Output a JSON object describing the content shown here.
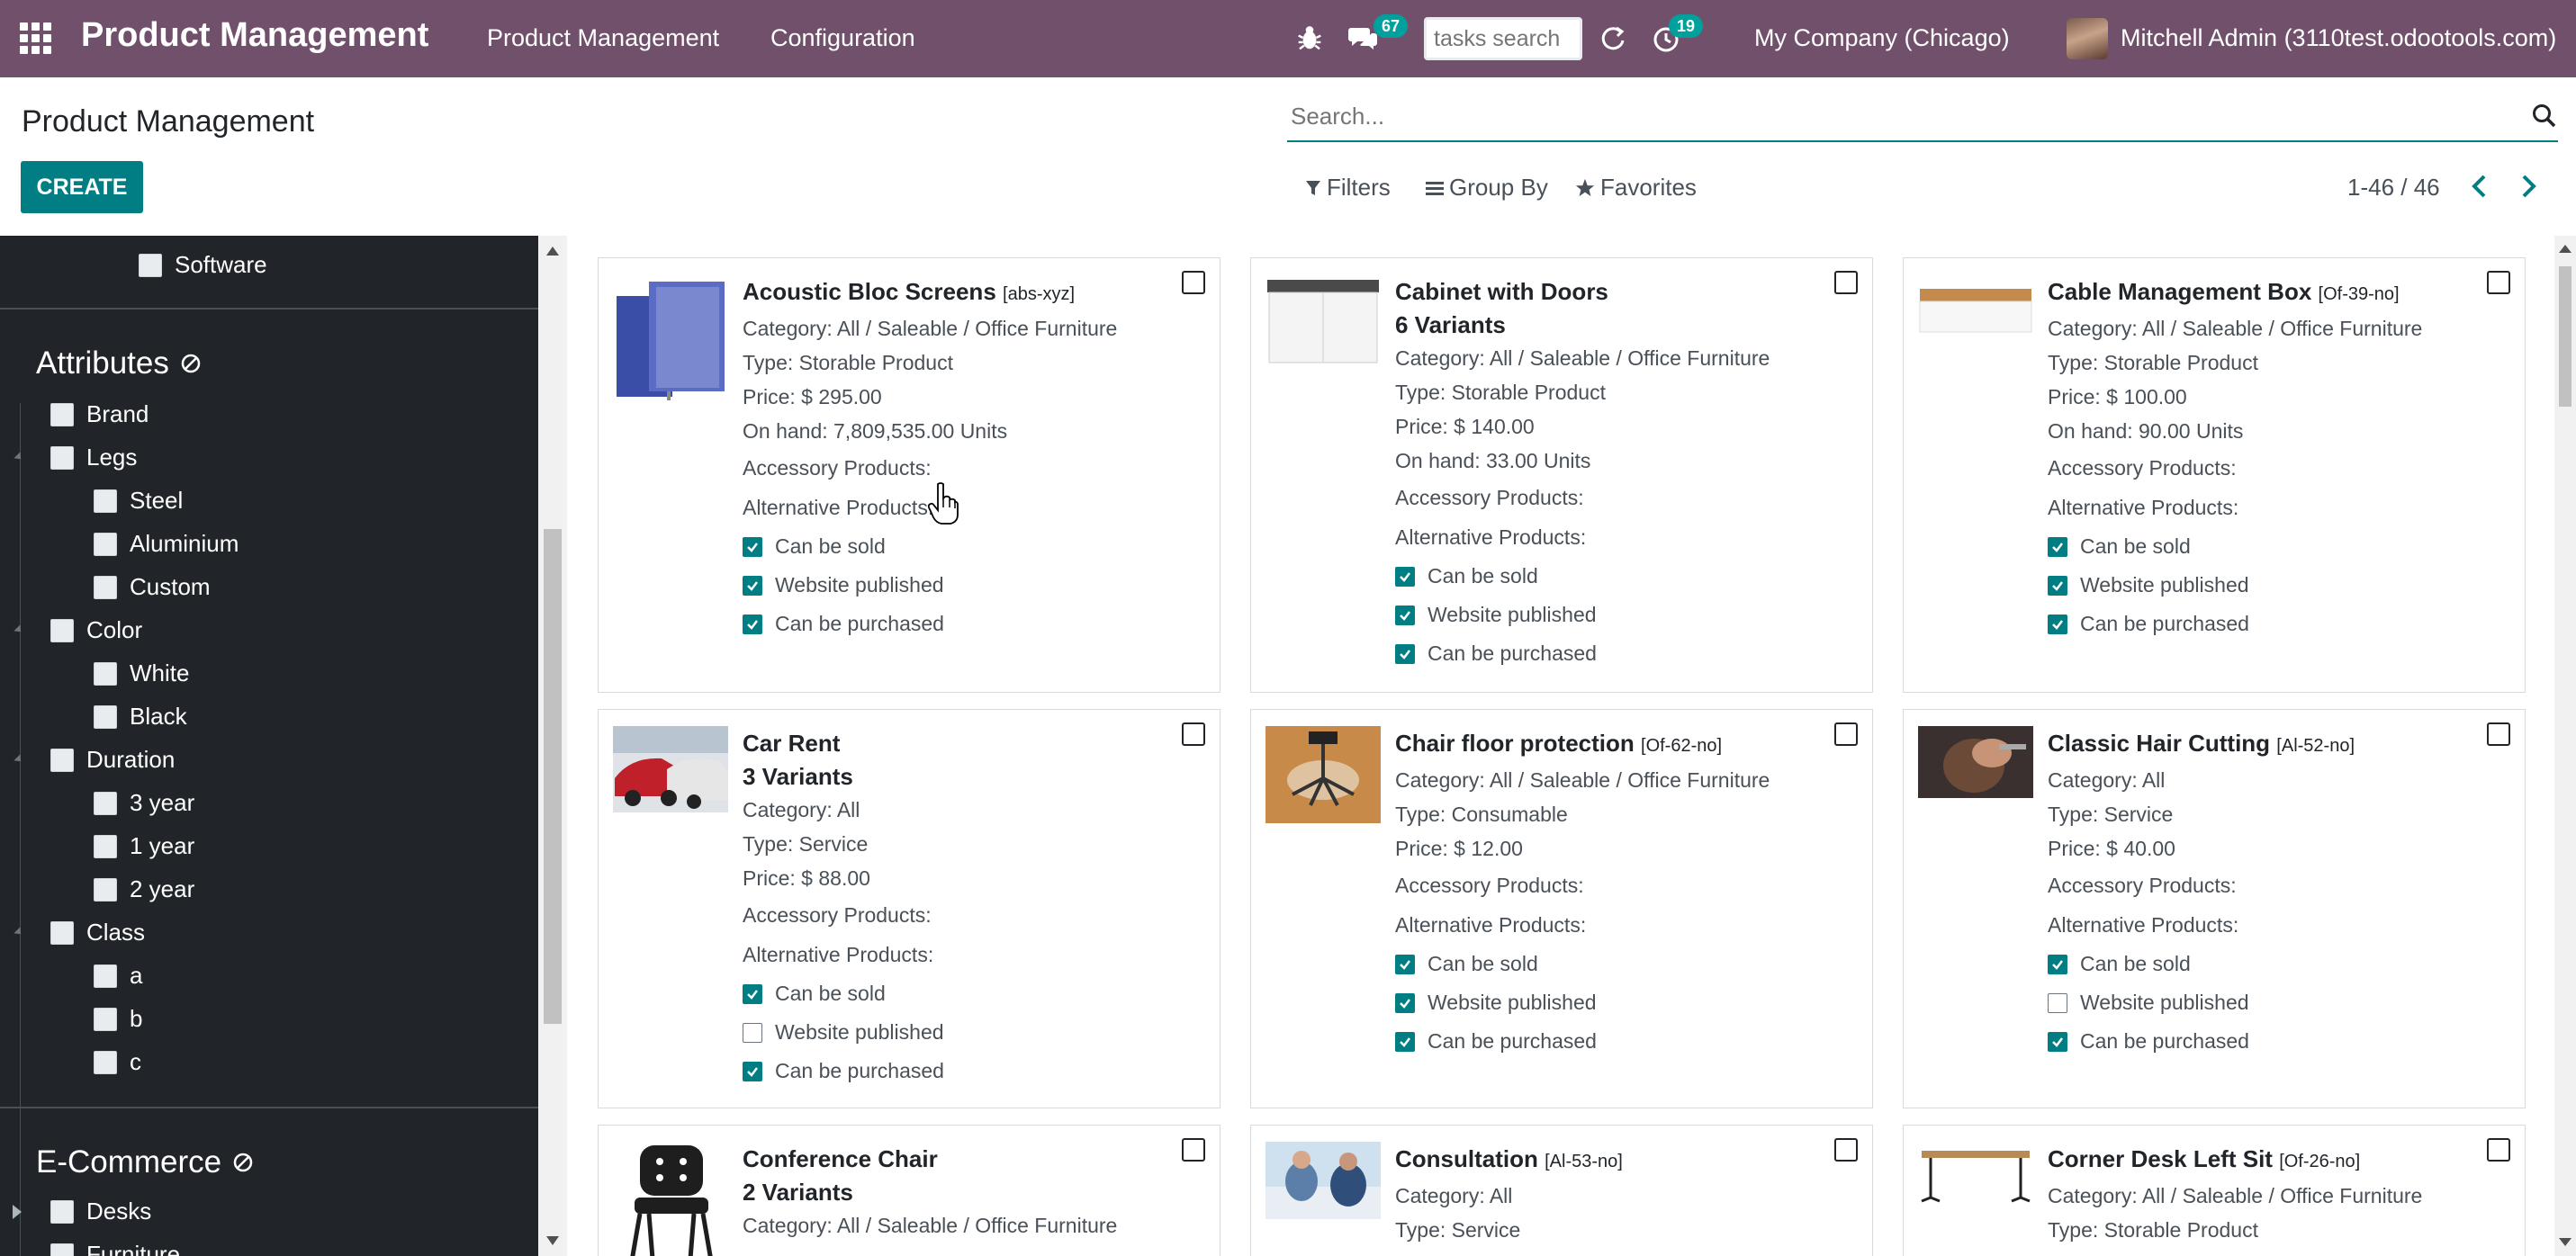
{
  "navbar": {
    "brand": "Product Management",
    "menu": [
      "Product Management",
      "Configuration"
    ],
    "chat_count": "67",
    "activity_count": "19",
    "tasks_search_placeholder": "tasks search",
    "company": "My Company (Chicago)",
    "user": "Mitchell Admin (3110test.odootools.com)",
    "bg_color": "#71506b"
  },
  "control_panel": {
    "title": "Product Management",
    "create_label": "CREATE",
    "search_placeholder": "Search...",
    "filters_label": "Filters",
    "groupby_label": "Group By",
    "favorites_label": "Favorites",
    "pager": "1-46 / 46"
  },
  "sidebar": {
    "software": "Software",
    "attributes_title": "Attributes",
    "brand": "Brand",
    "legs": "Legs",
    "legs_children": [
      "Steel",
      "Aluminium",
      "Custom"
    ],
    "color": "Color",
    "color_children": [
      "White",
      "Black"
    ],
    "duration": "Duration",
    "duration_children": [
      "3 year",
      "1 year",
      "2 year"
    ],
    "class": "Class",
    "class_children": [
      "a",
      "b",
      "c"
    ],
    "ecommerce_title": "E-Commerce",
    "desks": "Desks",
    "furniture": "Furniture"
  },
  "cards": [
    {
      "name": "Acoustic Bloc Screens",
      "ref": "[abs-xyz]",
      "variants": "",
      "category": "Category: All / Saleable / Office Furniture",
      "type": "Type: Storable Product",
      "price": "Price: $ 295.00",
      "onhand": "On hand: 7,809,535.00 Units",
      "accessory": "Accessory Products:",
      "alternative": "Alternative Products:",
      "sold": "Can be sold",
      "published": "Website published",
      "purchased": "Can be purchased",
      "sold_on": true,
      "published_on": true,
      "purchased_on": true
    },
    {
      "name": "Cabinet with Doors",
      "ref": "",
      "variants": "6 Variants",
      "category": "Category: All / Saleable / Office Furniture",
      "type": "Type: Storable Product",
      "price": "Price: $ 140.00",
      "onhand": "On hand: 33.00 Units",
      "accessory": "Accessory Products:",
      "alternative": "Alternative Products:",
      "sold": "Can be sold",
      "published": "Website published",
      "purchased": "Can be purchased",
      "sold_on": true,
      "published_on": true,
      "purchased_on": true
    },
    {
      "name": "Cable Management Box",
      "ref": "[Of-39-no]",
      "variants": "",
      "category": "Category: All / Saleable / Office Furniture",
      "type": "Type: Storable Product",
      "price": "Price: $ 100.00",
      "onhand": "On hand: 90.00 Units",
      "accessory": "Accessory Products:",
      "alternative": "Alternative Products:",
      "sold": "Can be sold",
      "published": "Website published",
      "purchased": "Can be purchased",
      "sold_on": true,
      "published_on": true,
      "purchased_on": true
    },
    {
      "name": "Car Rent",
      "ref": "",
      "variants": "3 Variants",
      "category": "Category: All",
      "type": "Type: Service",
      "price": "Price: $ 88.00",
      "onhand": "",
      "accessory": "Accessory Products:",
      "alternative": "Alternative Products:",
      "sold": "Can be sold",
      "published": "Website published",
      "purchased": "Can be purchased",
      "sold_on": true,
      "published_on": false,
      "purchased_on": true
    },
    {
      "name": "Chair floor protection",
      "ref": "[Of-62-no]",
      "variants": "",
      "category": "Category: All / Saleable / Office Furniture",
      "type": "Type: Consumable",
      "price": "Price: $ 12.00",
      "onhand": "",
      "accessory": "Accessory Products:",
      "alternative": "Alternative Products:",
      "sold": "Can be sold",
      "published": "Website published",
      "purchased": "Can be purchased",
      "sold_on": true,
      "published_on": true,
      "purchased_on": true
    },
    {
      "name": "Classic Hair Cutting",
      "ref": "[Al-52-no]",
      "variants": "",
      "category": "Category: All",
      "type": "Type: Service",
      "price": "Price: $ 40.00",
      "onhand": "",
      "accessory": "Accessory Products:",
      "alternative": "Alternative Products:",
      "sold": "Can be sold",
      "published": "Website published",
      "purchased": "Can be purchased",
      "sold_on": true,
      "published_on": false,
      "purchased_on": true
    },
    {
      "name": "Conference Chair",
      "ref": "",
      "variants": "2 Variants",
      "category": "Category: All / Saleable / Office Furniture",
      "type": "",
      "price": "",
      "onhand": "",
      "accessory": "",
      "alternative": "",
      "sold": "",
      "published": "",
      "purchased": ""
    },
    {
      "name": "Consultation",
      "ref": "[Al-53-no]",
      "variants": "",
      "category": "Category: All",
      "type": "Type: Service",
      "price": "",
      "onhand": "",
      "accessory": "",
      "alternative": "",
      "sold": "",
      "published": "",
      "purchased": ""
    },
    {
      "name": "Corner Desk Left Sit",
      "ref": "[Of-26-no]",
      "variants": "",
      "category": "Category: All / Saleable / Office Furniture",
      "type": "Type: Storable Product",
      "price": "",
      "onhand": "",
      "accessory": "",
      "alternative": "",
      "sold": "",
      "published": "",
      "purchased": ""
    }
  ]
}
